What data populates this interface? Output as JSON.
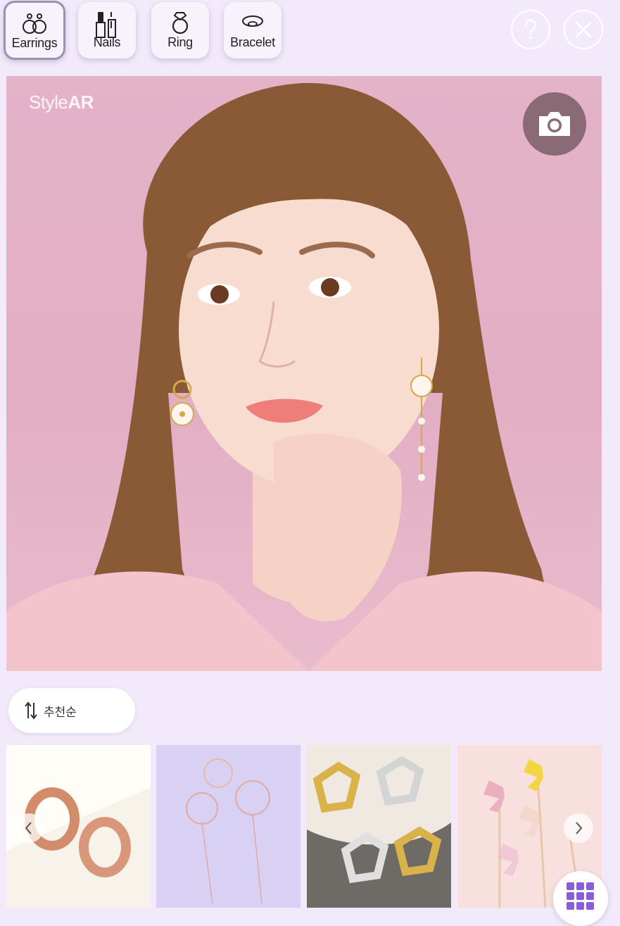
{
  "categories": [
    {
      "label": "Earrings",
      "icon": "earrings-icon",
      "active": true
    },
    {
      "label": "Nails",
      "icon": "nail-polish-icon",
      "active": false
    },
    {
      "label": "Ring",
      "icon": "ring-icon",
      "active": false
    },
    {
      "label": "Bracelet",
      "icon": "bracelet-icon",
      "active": false
    }
  ],
  "header_actions": {
    "help_icon": "question-icon",
    "close_icon": "close-icon"
  },
  "preview": {
    "logo_light": "Style",
    "logo_bold": "AR",
    "camera_icon": "camera-icon"
  },
  "sort": {
    "label": "추천순",
    "icon": "sort-arrows-icon"
  },
  "products": [
    {
      "name": "rose-gold-hoop-earrings"
    },
    {
      "name": "flower-drop-earrings"
    },
    {
      "name": "gold-silver-pentagon-hoops"
    },
    {
      "name": "butterfly-crystal-earrings"
    }
  ],
  "carousel": {
    "prev_icon": "chevron-left-icon",
    "next_icon": "chevron-right-icon"
  },
  "menu": {
    "icon": "grid-icon"
  },
  "colors": {
    "background": "#f2eafb",
    "accent": "#8a5ce0",
    "camera": "#8a6a74"
  }
}
